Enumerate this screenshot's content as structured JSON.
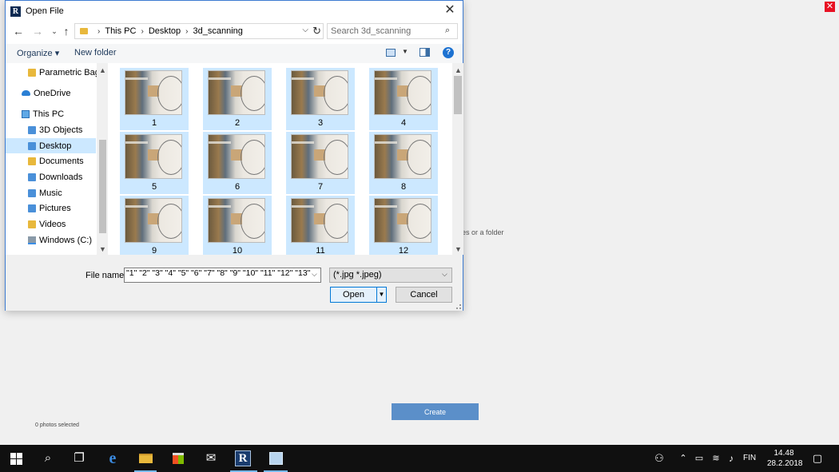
{
  "background_app": {
    "close_glyph": "✕",
    "hint_text": "es or a folder",
    "create_label": "Create",
    "status_text": "0 photos selected"
  },
  "dialog": {
    "app_icon": "R",
    "title": "Open File",
    "close_glyph": "✕",
    "breadcrumbs": [
      "This PC",
      "Desktop",
      "3d_scanning"
    ],
    "search_placeholder": "Search 3d_scanning",
    "toolbar": {
      "organize_label": "Organize ▾",
      "new_folder_label": "New folder",
      "help_glyph": "?"
    },
    "nav_items": [
      {
        "label": "Parametric Bag",
        "icon": "folder-icon"
      },
      {
        "label": "OneDrive",
        "icon": "cloud-icon"
      },
      {
        "label": "This PC",
        "icon": "computer-icon"
      },
      {
        "label": "3D Objects",
        "icon": "folder-icon"
      },
      {
        "label": "Desktop",
        "icon": "folder-icon",
        "selected": true
      },
      {
        "label": "Documents",
        "icon": "folder-icon"
      },
      {
        "label": "Downloads",
        "icon": "folder-icon"
      },
      {
        "label": "Music",
        "icon": "folder-icon"
      },
      {
        "label": "Pictures",
        "icon": "folder-icon"
      },
      {
        "label": "Videos",
        "icon": "folder-icon"
      },
      {
        "label": "Windows (C:)",
        "icon": "drive-icon"
      }
    ],
    "files": [
      "1",
      "2",
      "3",
      "4",
      "5",
      "6",
      "7",
      "8",
      "9",
      "10",
      "11",
      "12"
    ],
    "file_name_label": "File name:",
    "file_name_value": "\"1\" \"2\" \"3\" \"4\" \"5\" \"6\" \"7\" \"8\" \"9\" \"10\" \"11\" \"12\" \"13\"",
    "file_type_value": "(*.jpg *.jpeg)",
    "open_label": "Open",
    "cancel_label": "Cancel"
  },
  "taskbar": {
    "language": "FIN",
    "time": "14.48",
    "date": "28.2.2018",
    "revit_glyph": "R"
  },
  "colors": {
    "selection": "#cce8ff",
    "accent": "#0078d7",
    "taskbar": "#101010"
  }
}
